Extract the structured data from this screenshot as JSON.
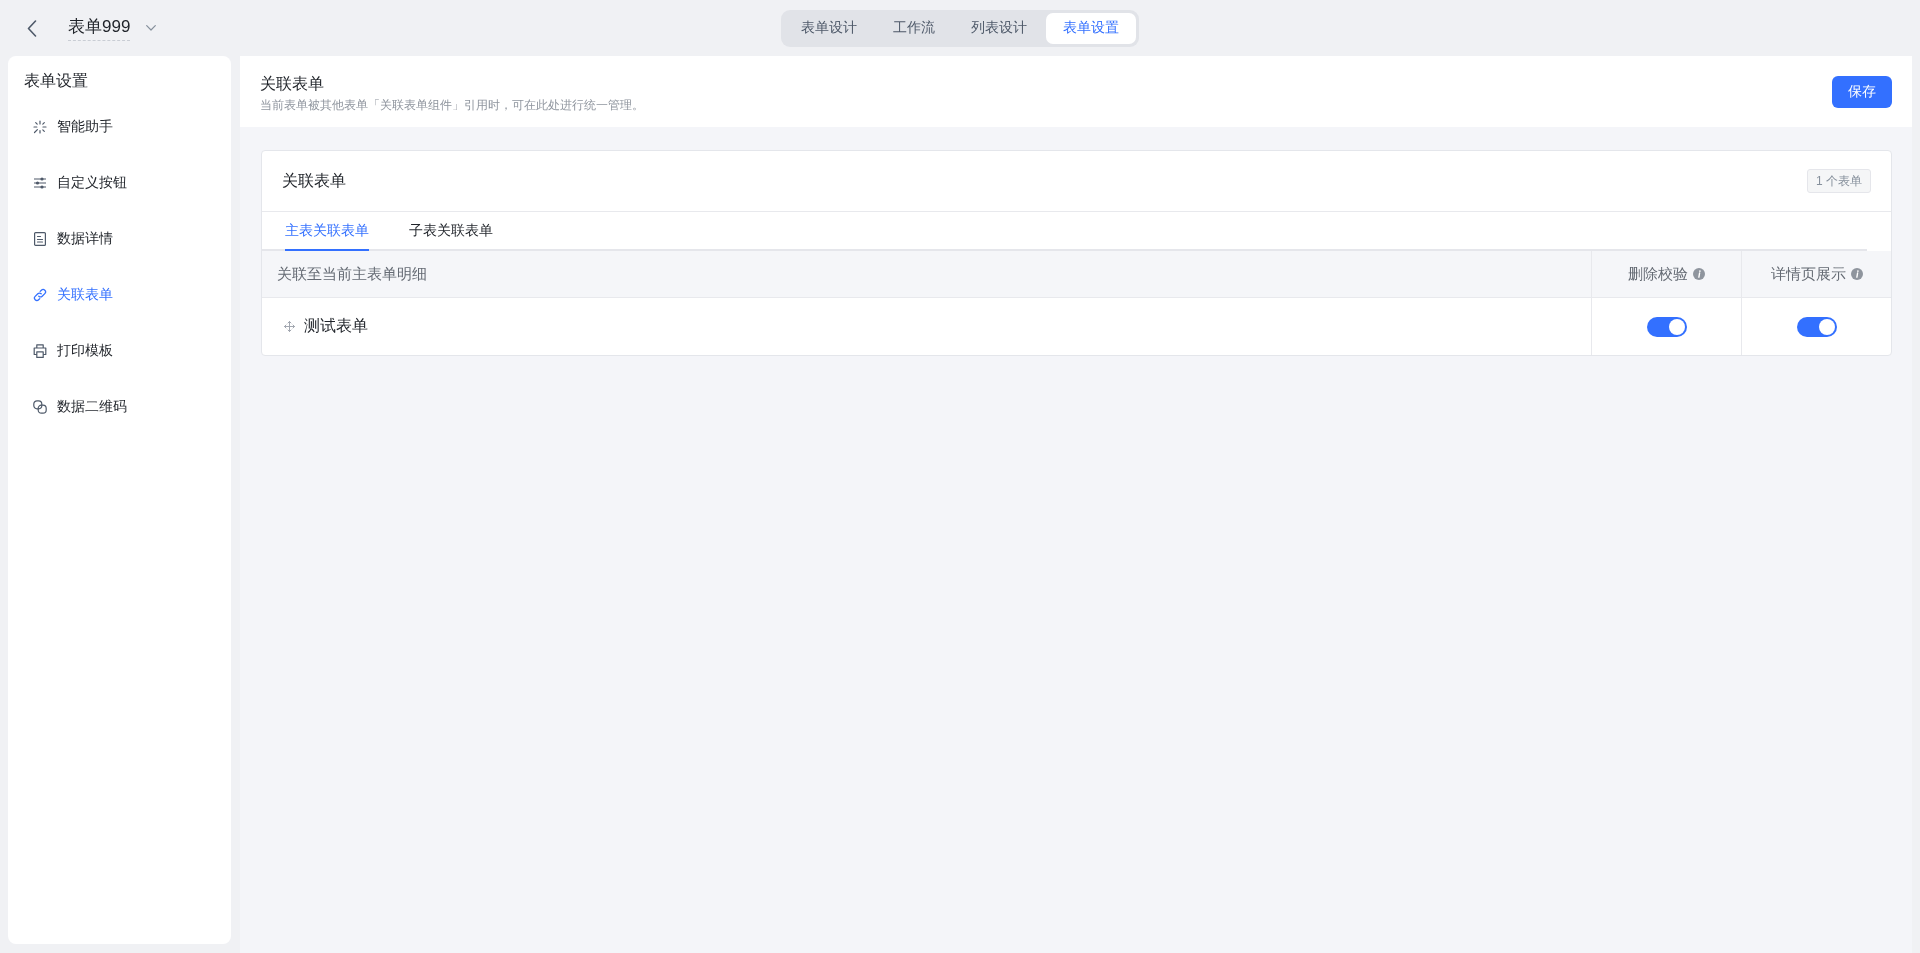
{
  "top_bar": {
    "title": "表单999",
    "tabs": [
      {
        "label": "表单设计",
        "selected": false
      },
      {
        "label": "工作流",
        "selected": false
      },
      {
        "label": "列表设计",
        "selected": false
      },
      {
        "label": "表单设置",
        "selected": true
      }
    ]
  },
  "sidebar": {
    "title": "表单设置",
    "items": [
      {
        "label": "智能助手",
        "selected": false
      },
      {
        "label": "自定义按钮",
        "selected": false
      },
      {
        "label": "数据详情",
        "selected": false
      },
      {
        "label": "关联表单",
        "selected": true
      },
      {
        "label": "打印模板",
        "selected": false
      },
      {
        "label": "数据二维码",
        "selected": false
      }
    ]
  },
  "page_header": {
    "title": "关联表单",
    "description": "当前表单被其他表单「关联表单组件」引用时，可在此处进行统一管理。",
    "save_button": "保存"
  },
  "card": {
    "title": "关联表单",
    "count_badge": "1 个表单",
    "tabs": [
      {
        "label": "主表关联表单",
        "selected": true
      },
      {
        "label": "子表关联表单",
        "selected": false
      }
    ],
    "table": {
      "columns": [
        {
          "label": "关联至当前主表单明细",
          "info": false
        },
        {
          "label": "删除校验",
          "info": true
        },
        {
          "label": "详情页展示",
          "info": true
        }
      ],
      "rows": [
        {
          "name": "测试表单",
          "delete_check": true,
          "detail_display": true
        }
      ]
    }
  }
}
